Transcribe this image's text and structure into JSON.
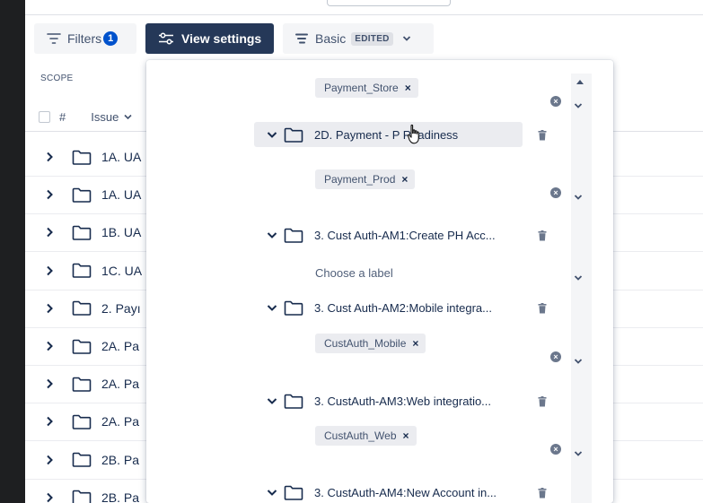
{
  "toolbar": {
    "filters_label": "Filters",
    "filters_count": "1",
    "view_settings_label": "View settings",
    "basic_label": "Basic",
    "basic_status": "EDITED"
  },
  "table": {
    "scope_label": "SCOPE",
    "col_number": "#",
    "col_issue": "Issue",
    "rows": [
      "1A. UA",
      "1A. UA",
      "1B. UA",
      "1C. UA",
      "2. Payı",
      "2A. Pa",
      "2A. Pa",
      "2A. Pa",
      "2B. Pa",
      "2B. Pa"
    ]
  },
  "panel": {
    "items": [
      {
        "type": "tag",
        "text": "Payment_Store"
      },
      {
        "type": "group",
        "text": "2D. Payment - P Readiness"
      },
      {
        "type": "tag",
        "text": "Payment_Prod"
      },
      {
        "type": "group",
        "text": "3. Cust Auth-AM1:Create PH Acc..."
      },
      {
        "type": "placeholder",
        "text": "Choose a label"
      },
      {
        "type": "group",
        "text": "3. Cust Auth-AM2:Mobile integra..."
      },
      {
        "type": "tag",
        "text": "CustAuth_Mobile"
      },
      {
        "type": "group",
        "text": "3. CustAuth-AM3:Web integratio..."
      },
      {
        "type": "tag",
        "text": "CustAuth_Web"
      },
      {
        "type": "group",
        "text": "3. CustAuth-AM4:New Account in..."
      }
    ],
    "remove_glyph": "×"
  },
  "colors": {
    "primary_dark": "#253858",
    "badge_blue": "#0052cc",
    "text": "#172b4d",
    "muted": "#42526e"
  },
  "icons": [
    "filter-icon",
    "sliders-icon",
    "layout-icon",
    "chevron-down-icon",
    "folder-icon",
    "chevron-right-icon",
    "trash-icon",
    "clear-icon",
    "hand-cursor-icon"
  ]
}
